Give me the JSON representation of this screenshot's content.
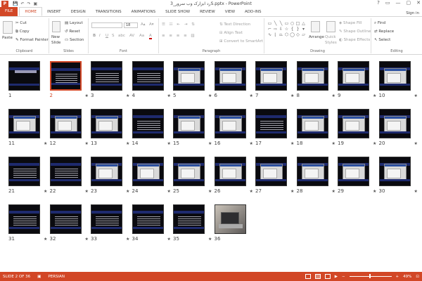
{
  "window": {
    "app_icon": "P",
    "title": "رد ابزارک وب سرور_3S.pptx - PowerPoint",
    "controls": [
      "?",
      "▭",
      "—",
      "▢",
      "✕"
    ]
  },
  "qat": [
    "💾",
    "↶",
    "↷",
    "▣"
  ],
  "tabs": [
    "FILE",
    "HOME",
    "INSERT",
    "DESIGN",
    "TRANSITIONS",
    "ANIMATIONS",
    "SLIDE SHOW",
    "REVIEW",
    "VIEW",
    "ADD-INS"
  ],
  "active_tab": "HOME",
  "sign_in": "Sign in",
  "ribbon": {
    "clipboard": {
      "label": "Clipboard",
      "paste": "Paste",
      "cut": "Cut",
      "copy": "Copy",
      "format_painter": "Format Painter"
    },
    "slides": {
      "label": "Slides",
      "new_slide": "New",
      "new_slide2": "Slide",
      "layout": "Layout",
      "reset": "Reset",
      "section": "Section"
    },
    "font": {
      "label": "Font",
      "size": "18",
      "bold": "B",
      "italic": "I",
      "underline": "U",
      "strike": "S",
      "shadow": "abc",
      "spacing": "AV",
      "case": "Aa",
      "color": "A"
    },
    "paragraph": {
      "label": "Paragraph",
      "text_direction": "Text Direction",
      "align_text": "Align Text",
      "convert": "Convert to SmartArt"
    },
    "drawing": {
      "label": "Drawing",
      "arrange": "Arrange",
      "quick_styles": "Quick",
      "quick_styles2": "Styles",
      "shape_fill": "Shape Fill",
      "shape_outline": "Shape Outline",
      "shape_effects": "Shape Effects"
    },
    "editing": {
      "label": "Editing",
      "find": "Find",
      "replace": "Replace",
      "select": "Select"
    }
  },
  "slides": [
    {
      "n": "1",
      "kind": "title",
      "star": ""
    },
    {
      "n": "2",
      "kind": "text",
      "star": "★"
    },
    {
      "n": "3",
      "kind": "text",
      "star": "★"
    },
    {
      "n": "4",
      "kind": "text",
      "star": "★"
    },
    {
      "n": "5",
      "kind": "shot",
      "star": "★"
    },
    {
      "n": "6",
      "kind": "shot",
      "star": "★"
    },
    {
      "n": "7",
      "kind": "shot",
      "star": "★"
    },
    {
      "n": "8",
      "kind": "shot",
      "star": "★"
    },
    {
      "n": "9",
      "kind": "shot",
      "star": "★"
    },
    {
      "n": "10",
      "kind": "shot",
      "star": "★"
    },
    {
      "n": "11",
      "kind": "shot",
      "star": "★"
    },
    {
      "n": "12",
      "kind": "shot",
      "star": "★"
    },
    {
      "n": "13",
      "kind": "shot",
      "star": "★"
    },
    {
      "n": "14",
      "kind": "text",
      "star": "★"
    },
    {
      "n": "15",
      "kind": "shot",
      "star": "★"
    },
    {
      "n": "16",
      "kind": "shot",
      "star": "★"
    },
    {
      "n": "17",
      "kind": "text",
      "star": "★"
    },
    {
      "n": "18",
      "kind": "shot",
      "star": "★"
    },
    {
      "n": "19",
      "kind": "shot",
      "star": "★"
    },
    {
      "n": "20",
      "kind": "shot",
      "star": "★"
    },
    {
      "n": "21",
      "kind": "text",
      "star": "★"
    },
    {
      "n": "22",
      "kind": "text",
      "star": "★"
    },
    {
      "n": "23",
      "kind": "shot",
      "star": "★"
    },
    {
      "n": "24",
      "kind": "shot",
      "star": "★"
    },
    {
      "n": "25",
      "kind": "shot",
      "star": "★"
    },
    {
      "n": "26",
      "kind": "shot",
      "star": "★"
    },
    {
      "n": "27",
      "kind": "shot",
      "star": "★"
    },
    {
      "n": "28",
      "kind": "shot",
      "star": "★"
    },
    {
      "n": "29",
      "kind": "shot",
      "star": "★"
    },
    {
      "n": "30",
      "kind": "shot",
      "star": "★"
    },
    {
      "n": "31",
      "kind": "text",
      "star": "★"
    },
    {
      "n": "32",
      "kind": "text",
      "star": "★"
    },
    {
      "n": "33",
      "kind": "text",
      "star": "★"
    },
    {
      "n": "34",
      "kind": "text",
      "star": "★"
    },
    {
      "n": "35",
      "kind": "text",
      "star": "★"
    },
    {
      "n": "36",
      "kind": "photo",
      "star": ""
    }
  ],
  "selected_slide": "2",
  "status": {
    "slide_info": "SLIDE 2 OF 36",
    "language": "PERSIAN",
    "zoom": "49%",
    "zoom_minus": "−",
    "zoom_plus": "+"
  },
  "colors": {
    "accent": "#d24726",
    "slide_bg": "#0a0a0f",
    "slide_band": "#1e2a6e"
  }
}
